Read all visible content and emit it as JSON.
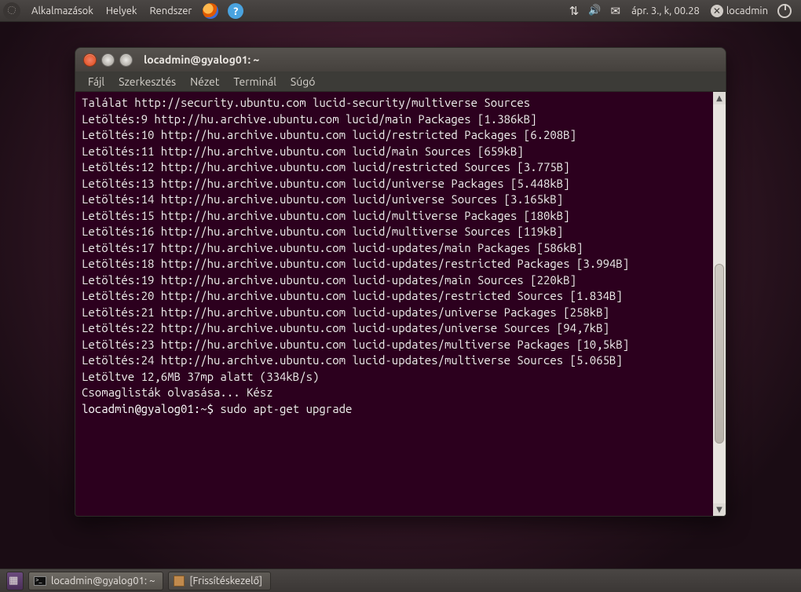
{
  "top_panel": {
    "menus": {
      "apps": "Alkalmazások",
      "places": "Helyek",
      "system": "Rendszer"
    },
    "datetime": "ápr.  3., k, 00.28",
    "username": "locadmin"
  },
  "terminal": {
    "title": "locadmin@gyalog01: ~",
    "menubar": {
      "file": "Fájl",
      "edit": "Szerkesztés",
      "view": "Nézet",
      "terminal": "Terminál",
      "help": "Súgó"
    },
    "lines": [
      "Találat http://security.ubuntu.com lucid-security/multiverse Sources",
      "Letöltés:9 http://hu.archive.ubuntu.com lucid/main Packages [1.386kB]",
      "Letöltés:10 http://hu.archive.ubuntu.com lucid/restricted Packages [6.208B]",
      "Letöltés:11 http://hu.archive.ubuntu.com lucid/main Sources [659kB]",
      "Letöltés:12 http://hu.archive.ubuntu.com lucid/restricted Sources [3.775B]",
      "Letöltés:13 http://hu.archive.ubuntu.com lucid/universe Packages [5.448kB]",
      "Letöltés:14 http://hu.archive.ubuntu.com lucid/universe Sources [3.165kB]",
      "Letöltés:15 http://hu.archive.ubuntu.com lucid/multiverse Packages [180kB]",
      "Letöltés:16 http://hu.archive.ubuntu.com lucid/multiverse Sources [119kB]",
      "Letöltés:17 http://hu.archive.ubuntu.com lucid-updates/main Packages [586kB]",
      "Letöltés:18 http://hu.archive.ubuntu.com lucid-updates/restricted Packages [3.994B]",
      "Letöltés:19 http://hu.archive.ubuntu.com lucid-updates/main Sources [220kB]",
      "Letöltés:20 http://hu.archive.ubuntu.com lucid-updates/restricted Sources [1.834B]",
      "Letöltés:21 http://hu.archive.ubuntu.com lucid-updates/universe Packages [258kB]",
      "Letöltés:22 http://hu.archive.ubuntu.com lucid-updates/universe Sources [94,7kB]",
      "Letöltés:23 http://hu.archive.ubuntu.com lucid-updates/multiverse Packages [10,5kB]",
      "Letöltés:24 http://hu.archive.ubuntu.com lucid-updates/multiverse Sources [5.065B]",
      "Letöltve 12,6MB 37mp alatt (334kB/s)",
      "Csomaglisták olvasása... Kész"
    ],
    "prompt": "locadmin@gyalog01:~$ ",
    "command": "sudo apt-get upgrade"
  },
  "bottom_panel": {
    "task1": "locadmin@gyalog01: ~",
    "task2": "[Frissítéskezelő]"
  }
}
